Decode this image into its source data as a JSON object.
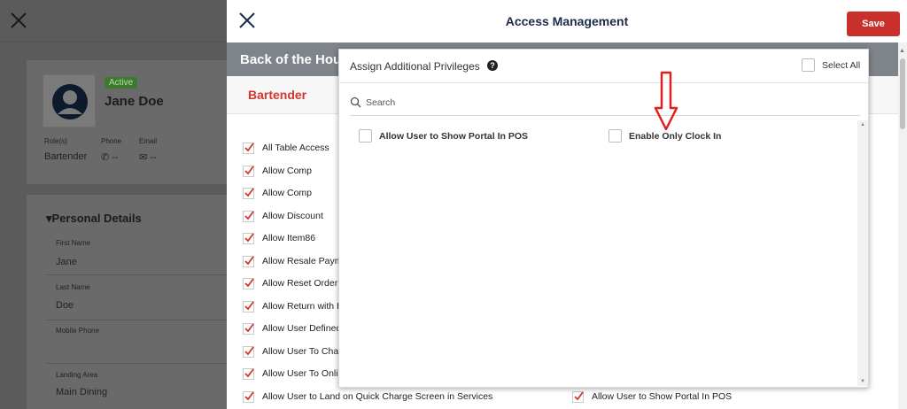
{
  "background": {
    "profile": {
      "status": "Active",
      "name": "Jane Doe",
      "role_label": "Role(s)",
      "role_value": "Bartender",
      "phone_label": "Phone",
      "phone_value": "--",
      "email_label": "Email",
      "email_value": "--"
    },
    "personal_details": {
      "title": "Personal Details",
      "fields": [
        {
          "label": "First Name",
          "value": "Jane"
        },
        {
          "label": "Last Name",
          "value": "Doe"
        },
        {
          "label": "Mobile Phone",
          "value": ""
        },
        {
          "label": "Landing Area",
          "value": "Main Dining"
        }
      ]
    }
  },
  "panel": {
    "title": "Access Management",
    "save_label": "Save",
    "section_title": "Back of the Hou",
    "role_tab": "Bartender",
    "privileges_left": [
      "All Table Access",
      "Allow Comp",
      "Allow Comp",
      "Allow Discount",
      "Allow Item86",
      "Allow Resale Paym",
      "Allow Reset Order",
      "Allow Return with I",
      "Allow User Defined",
      "Allow User To Cha",
      "Allow User To Onli",
      "Allow User to Land on Quick Charge Screen in Services"
    ],
    "privileges_right": [
      "Allow User to Show Portal In POS"
    ]
  },
  "modal": {
    "title": "Assign Additional Privileges",
    "help_icon": "question-circle-icon",
    "select_all_label": "Select All",
    "search_placeholder": "Search",
    "options": [
      "Allow User to Show Portal In POS",
      "Enable Only Clock In"
    ]
  },
  "colors": {
    "accent_red": "#d2362d",
    "save_button": "#c9302c",
    "section_bar": "#7e848a",
    "annotation_arrow": "#e02020"
  }
}
